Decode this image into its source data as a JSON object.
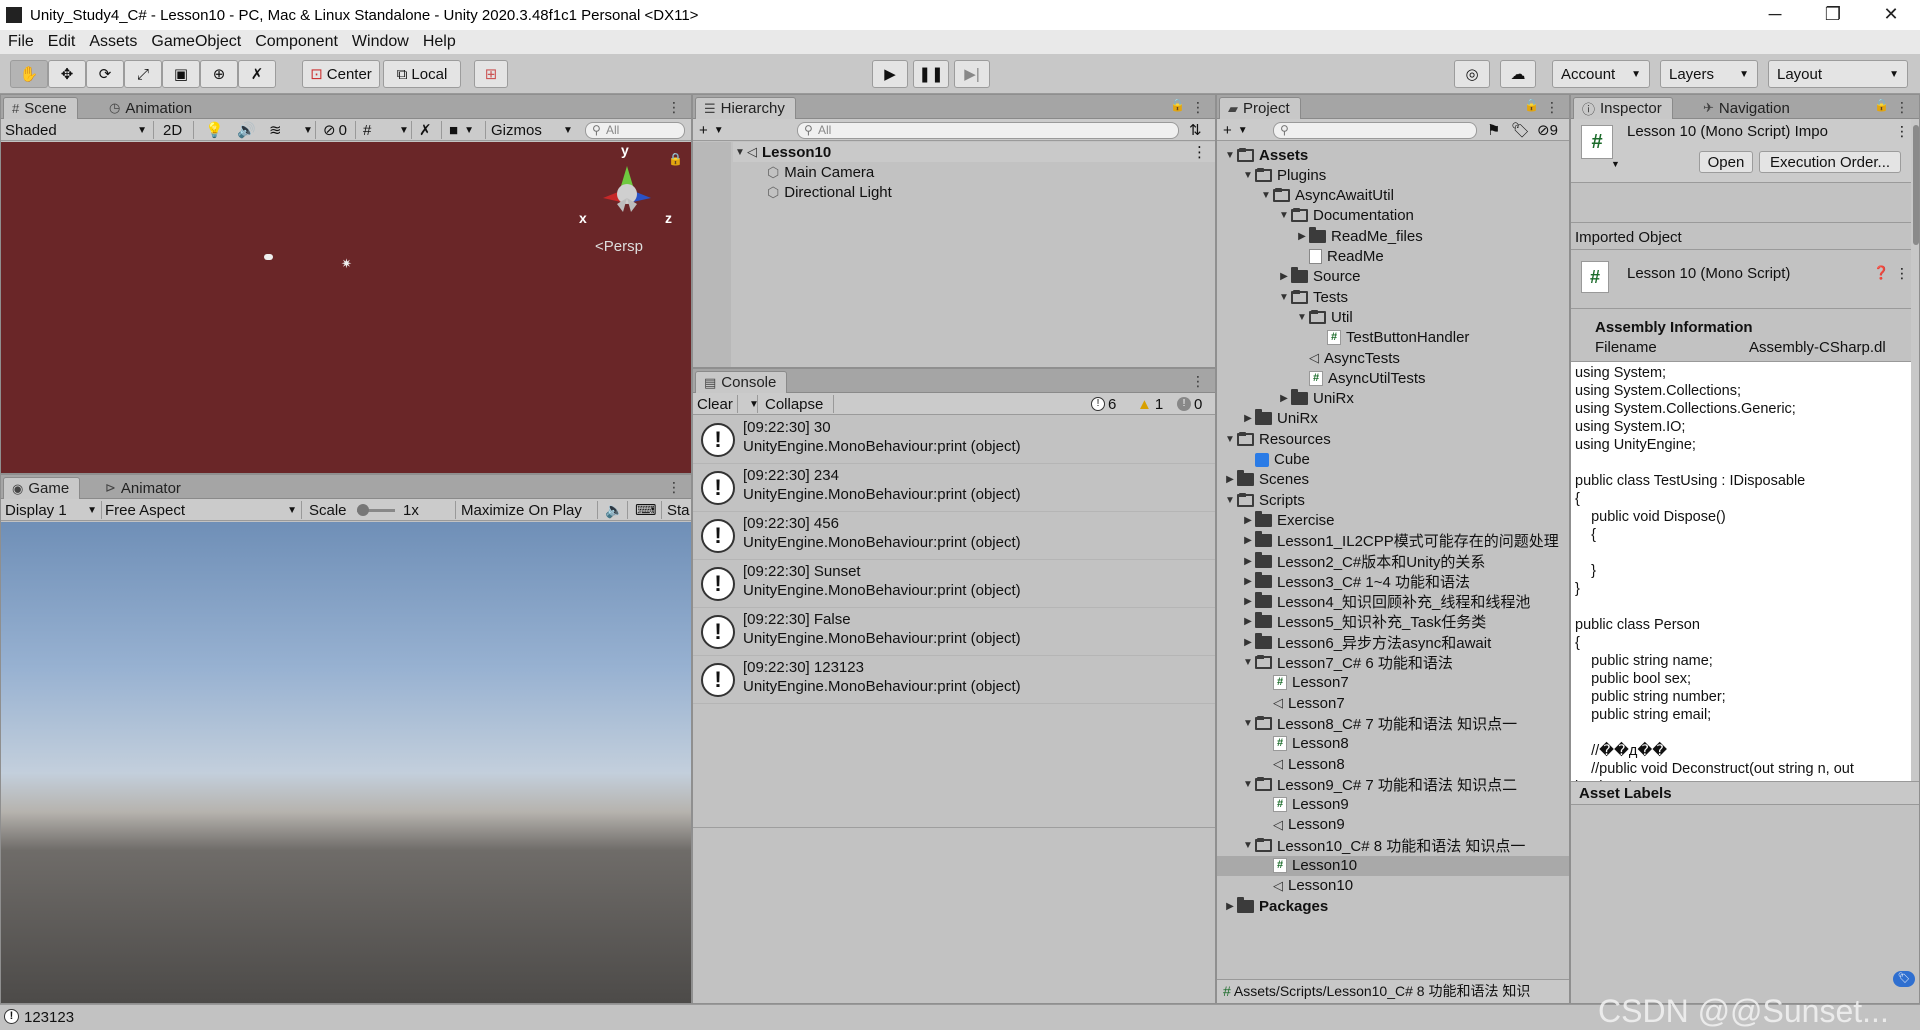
{
  "window": {
    "title": "Unity_Study4_C# - Lesson10 - PC, Mac & Linux Standalone - Unity 2020.3.48f1c1 Personal <DX11>",
    "minimize": "─",
    "maximize": "❐",
    "close": "✕"
  },
  "menu": [
    "File",
    "Edit",
    "Assets",
    "GameObject",
    "Component",
    "Window",
    "Help"
  ],
  "toolbar": {
    "pivot": "Center",
    "space": "Local",
    "account": "Account",
    "layers": "Layers",
    "layout": "Layout"
  },
  "scene": {
    "tab_scene": "Scene",
    "tab_animation": "Animation",
    "shading": "Shaded",
    "mode2d": "2D",
    "hidden_count": "0",
    "gizmos": "Gizmos",
    "search_placeholder": "All",
    "gizmo_y": "y",
    "gizmo_x": "x",
    "gizmo_z": "z",
    "persp": "<Persp"
  },
  "game": {
    "tab_game": "Game",
    "tab_animator": "Animator",
    "display": "Display 1",
    "aspect": "Free Aspect",
    "scale_label": "Scale",
    "scale_value": "1x",
    "maximize": "Maximize On Play",
    "stats": "Sta"
  },
  "hierarchy": {
    "tab": "Hierarchy",
    "search_placeholder": "All",
    "scene_name": "Lesson10",
    "items": [
      "Main Camera",
      "Directional Light"
    ]
  },
  "console": {
    "tab": "Console",
    "clear": "Clear",
    "collapse": "Collapse",
    "info_count": "6",
    "warn_count": "1",
    "error_count": "0",
    "logs": [
      {
        "line1": "[09:22:30] 30",
        "line2": "UnityEngine.MonoBehaviour:print (object)"
      },
      {
        "line1": "[09:22:30] 234",
        "line2": "UnityEngine.MonoBehaviour:print (object)"
      },
      {
        "line1": "[09:22:30] 456",
        "line2": "UnityEngine.MonoBehaviour:print (object)"
      },
      {
        "line1": "[09:22:30] Sunset",
        "line2": "UnityEngine.MonoBehaviour:print (object)"
      },
      {
        "line1": "[09:22:30] False",
        "line2": "UnityEngine.MonoBehaviour:print (object)"
      },
      {
        "line1": "[09:22:30] 123123",
        "line2": "UnityEngine.MonoBehaviour:print (object)"
      }
    ]
  },
  "project": {
    "tab": "Project",
    "hidden_count": "9",
    "tree": [
      {
        "label": "Assets",
        "bold": true
      },
      {
        "label": "Plugins"
      },
      {
        "label": "AsyncAwaitUtil"
      },
      {
        "label": "Documentation"
      },
      {
        "label": "ReadMe_files"
      },
      {
        "label": "ReadMe"
      },
      {
        "label": "Source"
      },
      {
        "label": "Tests"
      },
      {
        "label": "Util"
      },
      {
        "label": "TestButtonHandler"
      },
      {
        "label": "AsyncTests"
      },
      {
        "label": "AsyncUtilTests"
      },
      {
        "label": "UniRx"
      },
      {
        "label": "UniRx"
      },
      {
        "label": "Resources"
      },
      {
        "label": "Cube"
      },
      {
        "label": "Scenes"
      },
      {
        "label": "Scripts"
      },
      {
        "label": "Exercise"
      },
      {
        "label": "Lesson1_IL2CPP模式可能存在的问题处理"
      },
      {
        "label": "Lesson2_C#版本和Unity的关系"
      },
      {
        "label": "Lesson3_C# 1~4 功能和语法"
      },
      {
        "label": "Lesson4_知识回顾补充_线程和线程池"
      },
      {
        "label": "Lesson5_知识补充_Task任务类"
      },
      {
        "label": "Lesson6_异步方法async和await"
      },
      {
        "label": "Lesson7_C# 6 功能和语法"
      },
      {
        "label": "Lesson7"
      },
      {
        "label": "Lesson7"
      },
      {
        "label": "Lesson8_C# 7 功能和语法 知识点一"
      },
      {
        "label": "Lesson8"
      },
      {
        "label": "Lesson8"
      },
      {
        "label": "Lesson9_C# 7 功能和语法 知识点二"
      },
      {
        "label": "Lesson9"
      },
      {
        "label": "Lesson9"
      },
      {
        "label": "Lesson10_C# 8 功能和语法 知识点一"
      },
      {
        "label": "Lesson10"
      },
      {
        "label": "Lesson10"
      },
      {
        "label": "Packages",
        "bold": true
      }
    ],
    "path": "Assets/Scripts/Lesson10_C# 8 功能和语法 知识"
  },
  "inspector": {
    "tab_inspector": "Inspector",
    "tab_navigation": "Navigation",
    "header_title": "Lesson 10 (Mono Script) Impo",
    "open": "Open",
    "exec_order": "Execution Order...",
    "imported_object": "Imported Object",
    "script_title": "Lesson 10 (Mono Script)",
    "assembly_info": "Assembly Information",
    "filename_label": "Filename",
    "filename_value": "Assembly-CSharp.dl",
    "code": "using System;\nusing System.Collections;\nusing System.Collections.Generic;\nusing System.IO;\nusing UnityEngine;\n\npublic class TestUsing : IDisposable\n{\n    public void Dispose()\n    {\n\n    }\n}\n\npublic class Person\n{\n    public string name;\n    public bool sex;\n    public string number;\n    public string email;\n\n    //��д��\n    //public void Deconstruct(out string n, out\nbool sex)\n    //{\n    //    n = name;\n    //    sex = this.sex;\n    //}\n    //ДК��д��\n    public void Deconstruct(out string n, out\nbool sex) => (n, sex) = (name, this.sex);",
    "asset_labels": "Asset Labels"
  },
  "statusbar": {
    "message": "123123",
    "watermark": "CSDN @@Sunset..."
  },
  "colors": {
    "scene_bg": "#6a2628",
    "sky_top": "#6f8fb7",
    "ground": "#4c4a48",
    "selection": "#c9c9c9"
  }
}
